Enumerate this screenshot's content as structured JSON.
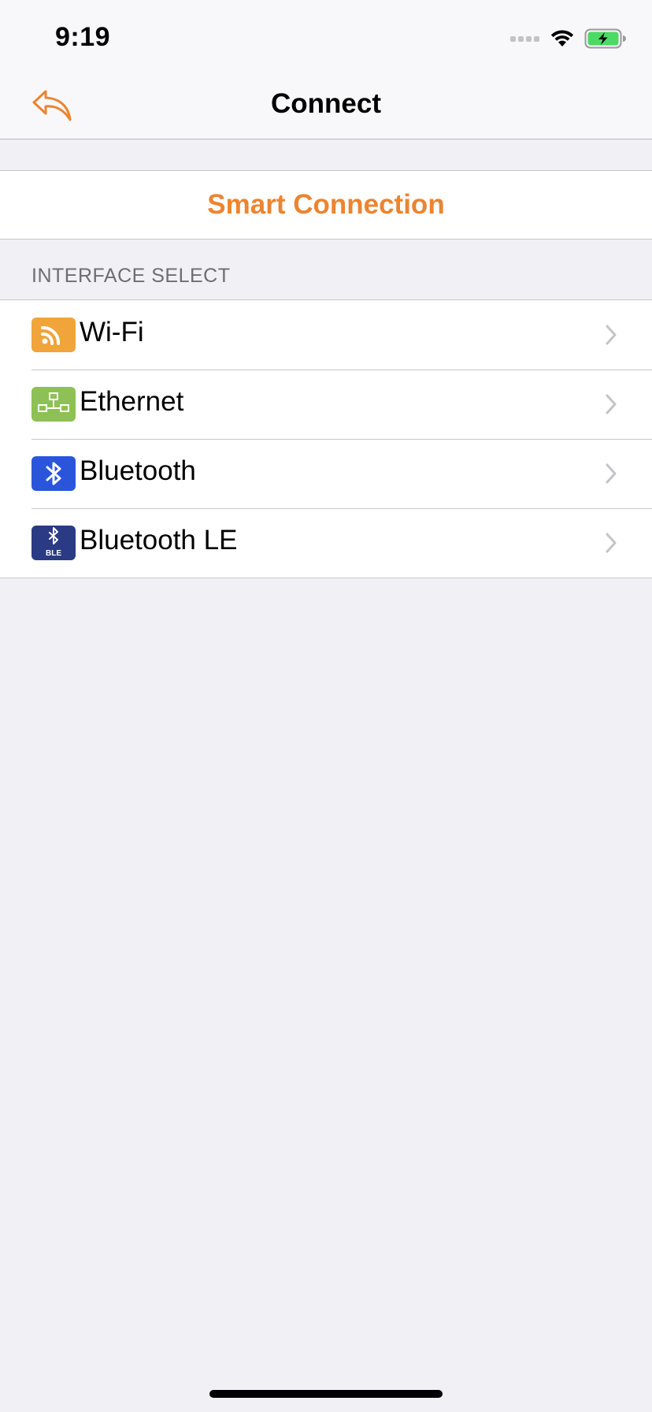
{
  "status_bar": {
    "time": "9:19"
  },
  "nav": {
    "title": "Connect",
    "back_icon": "reply-arrow-icon"
  },
  "smart_connection": {
    "label": "Smart Connection"
  },
  "section": {
    "header": "INTERFACE SELECT"
  },
  "interfaces": [
    {
      "label": "Wi-Fi",
      "icon": "wifi-signal-icon",
      "color": "#F0A43A"
    },
    {
      "label": "Ethernet",
      "icon": "ethernet-icon",
      "color": "#8DC155"
    },
    {
      "label": "Bluetooth",
      "icon": "bluetooth-icon",
      "color": "#2A55DA"
    },
    {
      "label": "Bluetooth LE",
      "icon": "bluetooth-le-icon",
      "color": "#2A3A85",
      "badge": "BLE"
    }
  ],
  "colors": {
    "accent": "#EC8430",
    "background": "#F0F0F5"
  }
}
